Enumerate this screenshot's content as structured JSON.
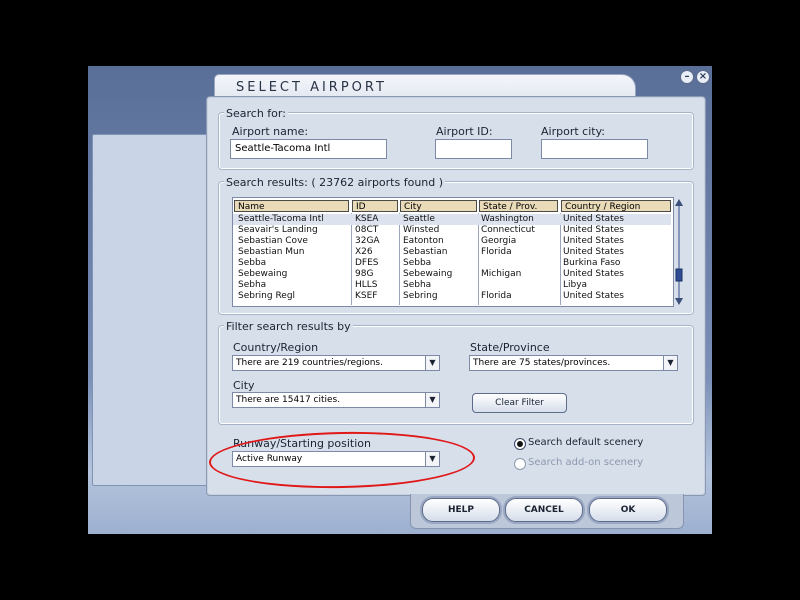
{
  "dialog": {
    "title": "SELECT AIRPORT"
  },
  "search": {
    "group_label": "Search for:",
    "airport_name_label": "Airport name:",
    "airport_name_value": "Seattle-Tacoma Intl",
    "airport_id_label": "Airport ID:",
    "airport_id_value": "",
    "airport_city_label": "Airport city:",
    "airport_city_value": ""
  },
  "results": {
    "group_label": "Search results: ( 23762 airports found )",
    "columns": [
      "Name",
      "ID",
      "City",
      "State / Prov.",
      "Country / Region"
    ],
    "rows": [
      [
        "Seattle-Tacoma Intl",
        "KSEA",
        "Seattle",
        "Washington",
        "United States"
      ],
      [
        "Seavair's Landing",
        "08CT",
        "Winsted",
        "Connecticut",
        "United States"
      ],
      [
        "Sebastian Cove",
        "32GA",
        "Eatonton",
        "Georgia",
        "United States"
      ],
      [
        "Sebastian Mun",
        "X26",
        "Sebastian",
        "Florida",
        "United States"
      ],
      [
        "Sebba",
        "DFES",
        "Sebba",
        "",
        "Burkina Faso"
      ],
      [
        "Sebewaing",
        "98G",
        "Sebewaing",
        "Michigan",
        "United States"
      ],
      [
        "Sebha",
        "HLLS",
        "Sebha",
        "",
        "Libya"
      ],
      [
        "Sebring Regl",
        "KSEF",
        "Sebring",
        "Florida",
        "United States"
      ]
    ],
    "selected_index": 0
  },
  "filter": {
    "group_label": "Filter search results by",
    "country_label": "Country/Region",
    "country_value": "There are 219 countries/regions.",
    "state_label": "State/Province",
    "state_value": "There are 75 states/provinces.",
    "city_label": "City",
    "city_value": "There are 15417 cities.",
    "clear_button": "Clear Filter"
  },
  "runway": {
    "label": "Runway/Starting position",
    "value": "Active Runway"
  },
  "scenery": {
    "default_label": "Search default scenery",
    "default_checked": true,
    "addon_label": "Search add-on scenery",
    "addon_checked": false
  },
  "buttons": {
    "help": "HELP",
    "cancel": "CANCEL",
    "ok": "OK"
  },
  "icons": {
    "minimize": "minimize-icon",
    "close": "close-icon",
    "dropdown": "chevron-down-icon",
    "scroll_up": "arrow-up-icon",
    "scroll_down": "arrow-down-icon"
  },
  "colors": {
    "annotation": "#e01818",
    "header_fill": "#eadbb8"
  }
}
